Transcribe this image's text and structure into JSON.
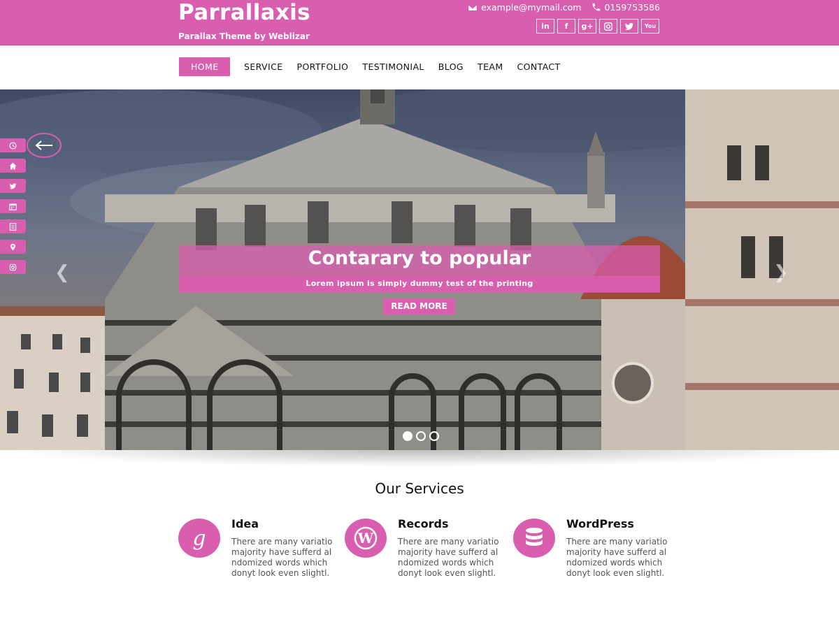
{
  "brand": {
    "title": "Parrallaxis",
    "subtitle": "Parallax Theme by Weblizar"
  },
  "contact": {
    "email": "example@mymail.com",
    "phone": "0159753586"
  },
  "social": [
    {
      "icon": "linkedin-icon",
      "label": "in"
    },
    {
      "icon": "facebook-icon",
      "label": "f"
    },
    {
      "icon": "google-plus-icon",
      "label": "g+"
    },
    {
      "icon": "instagram-icon",
      "label": ""
    },
    {
      "icon": "twitter-icon",
      "label": ""
    },
    {
      "icon": "youtube-icon",
      "label": "You"
    }
  ],
  "nav": {
    "items": [
      "HOME",
      "SERVICE",
      "PORTFOLIO",
      "TESTIMONIAL",
      "BLOG",
      "TEAM",
      "CONTACT"
    ],
    "active": "HOME"
  },
  "hero": {
    "title": "Contarary to popular",
    "subtitle": "Lorem ipsum is simply dummy test of the printing",
    "button": "READ MORE",
    "slides": 3,
    "active_slide": 1
  },
  "side_icons": [
    "clock-icon",
    "home-icon",
    "twitter-icon",
    "calendar-icon",
    "document-icon",
    "location-icon",
    "instagram-icon"
  ],
  "services": {
    "title": "Our Services",
    "items": [
      {
        "name": "Idea",
        "icon": "google-icon",
        "desc": "There are many variatio majority have sufferd al ndomized words which donyt look even slightl."
      },
      {
        "name": "Records",
        "icon": "wordpress-icon",
        "desc": "There are many variatio majority have sufferd al ndomized words which donyt look even slightl."
      },
      {
        "name": "WordPress",
        "icon": "database-icon",
        "desc": "There are many variatio majority have sufferd al ndomized words which donyt look even slightl."
      }
    ]
  },
  "colors": {
    "accent": "#d95eaf"
  }
}
